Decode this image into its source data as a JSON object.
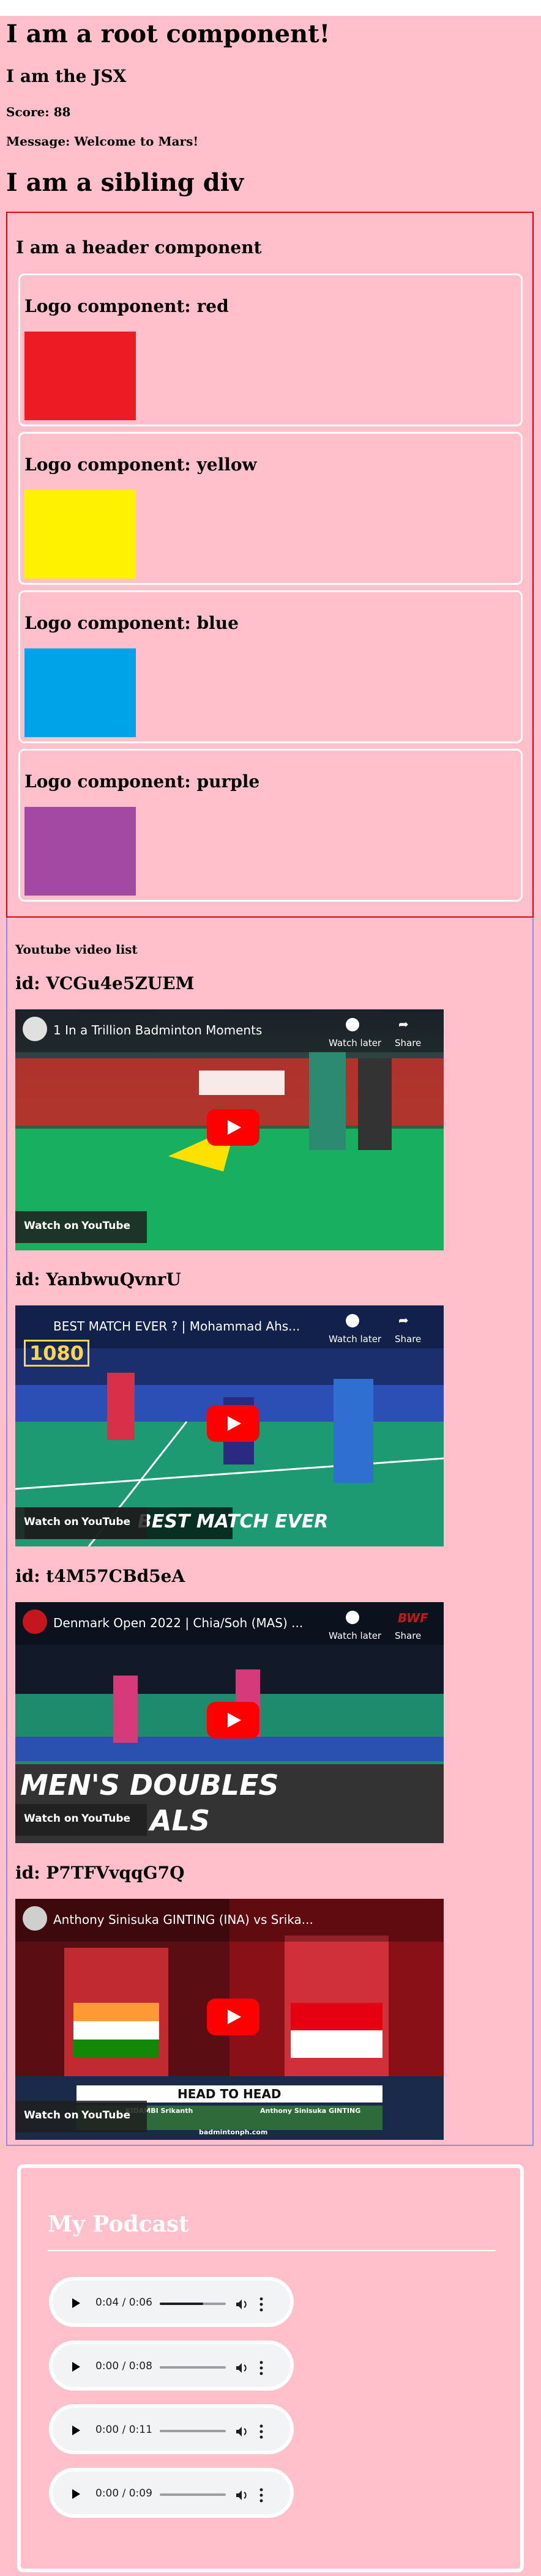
{
  "root": {
    "heading": "I am a root component!",
    "jsx_heading": "I am the JSX",
    "score": "Score: 88",
    "message": "Message: Welcome to Mars!",
    "sibling": "I am a sibling div"
  },
  "header": {
    "title": "I am a header component",
    "logos": [
      {
        "label": "Logo component: red",
        "color": "#ed1c24"
      },
      {
        "label": "Logo component: yellow",
        "color": "#fff200"
      },
      {
        "label": "Logo component: blue",
        "color": "#00a2e8"
      },
      {
        "label": "Logo component: purple",
        "color": "#a349a4"
      }
    ]
  },
  "youtube": {
    "label": "Youtube video list",
    "watch_later": "Watch later",
    "share": "Share",
    "watch_on": "Watch on",
    "youtube_brand": "YouTube",
    "videos": [
      {
        "id": "id: VCGu4e5ZUEM",
        "title": "1 In a Trillion Badminton Moments"
      },
      {
        "id": "id: YanbwuQvnrU",
        "title": "BEST MATCH EVER ? | Mohammad Ahs...",
        "overlay": "BEST MATCH EVER",
        "badge": "1080"
      },
      {
        "id": "id: t4M57CBd5eA",
        "title": "Denmark Open 2022 | Chia/Soh (MAS) ...",
        "overlay_top": "MEN'S DOUBLES",
        "overlay_bottom": "ALS",
        "channel_badge": "BWF"
      },
      {
        "id": "id: P7TFVvqqG7Q",
        "title": "Anthony Sinisuka GINTING (INA) vs Srika...",
        "banner": "HEAD TO HEAD",
        "left_name": "KIDAMBI Srikanth",
        "right_name": "Anthony Sinisuka GINTING",
        "footer": "badmintonph.com"
      }
    ]
  },
  "podcast": {
    "title": "My Podcast",
    "players": [
      {
        "time": "0:04 / 0:06",
        "progress": 0.66
      },
      {
        "time": "0:00 / 0:08",
        "progress": 0
      },
      {
        "time": "0:00 / 0:11",
        "progress": 0
      },
      {
        "time": "0:00 / 0:09",
        "progress": 0
      }
    ]
  }
}
